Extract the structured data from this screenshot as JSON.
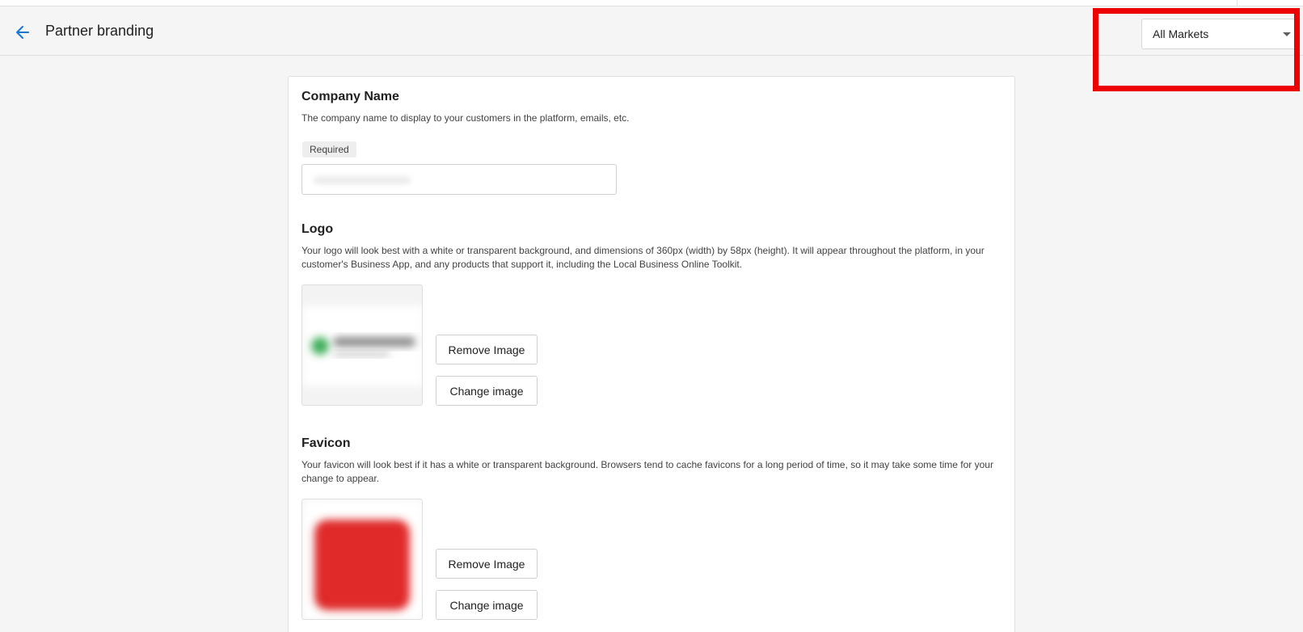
{
  "header": {
    "back_icon": "arrow-left-icon",
    "title": "Partner branding",
    "market_select": {
      "value": "All Markets",
      "icon": "caret-down-icon"
    }
  },
  "company_name": {
    "title": "Company Name",
    "description": "The company name to display to your customers in the platform, emails, etc.",
    "required_chip": "Required",
    "value": ""
  },
  "logo": {
    "title": "Logo",
    "description": "Your logo will look best with a white or transparent background, and dimensions of 360px (width) by 58px (height). It will appear throughout the platform, in your customer's Business App, and any products that support it, including the Local Business Online Toolkit.",
    "remove_label": "Remove Image",
    "change_label": "Change image"
  },
  "favicon": {
    "title": "Favicon",
    "description": "Your favicon will look best if it has a white or transparent background. Browsers tend to cache favicons for a long period of time, so it may take some time for your change to appear.",
    "remove_label": "Remove Image",
    "change_label": "Change image"
  },
  "colors": {
    "accent": "#1976d2",
    "highlight": "#ec0000",
    "favicon_fill": "#e0292b",
    "logo_mark": "#3fae5a"
  }
}
